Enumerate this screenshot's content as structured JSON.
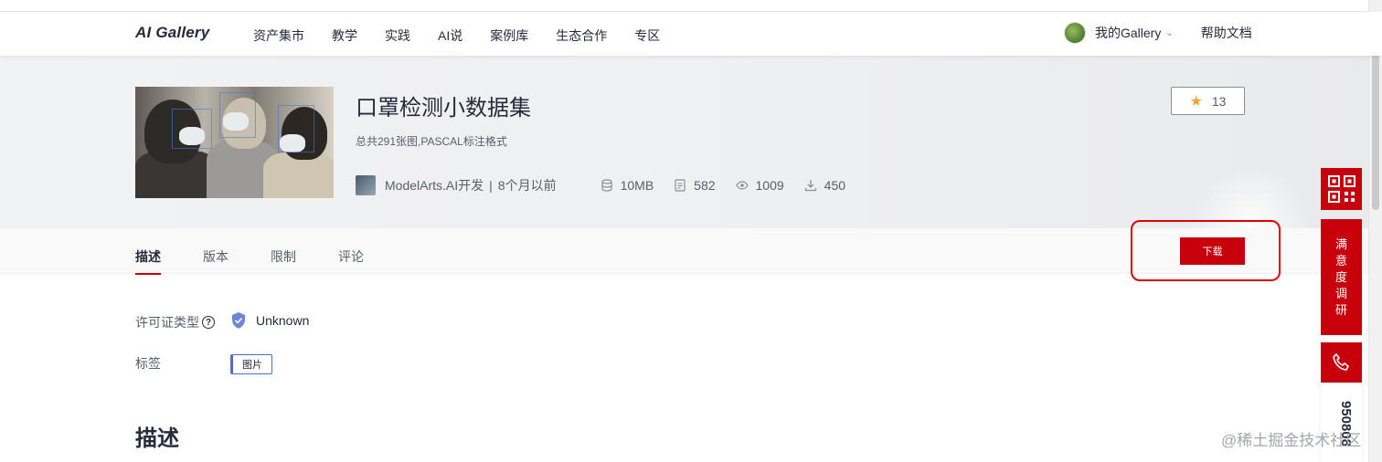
{
  "brand": {
    "logo_prefix": "AI G",
    "logo_suffix": "allery",
    "accent": "#c7000b"
  },
  "nav": {
    "menu": [
      "资产集市",
      "教学",
      "实践",
      "AI说",
      "案例库",
      "生态合作",
      "专区"
    ],
    "my_gallery": "我的Gallery",
    "help": "帮助文档"
  },
  "dataset": {
    "title": "口罩检测小数据集",
    "subtitle": "总共291张图,PASCAL标注格式",
    "publisher": "ModelArts.AI开发",
    "separator": "|",
    "published": "8个月以前",
    "size": "10MB",
    "files": "582",
    "views": "1009",
    "downloads": "450",
    "stars": "13"
  },
  "tabs": [
    "描述",
    "版本",
    "限制",
    "评论"
  ],
  "download_label": "下载",
  "info": {
    "license_label": "许可证类型",
    "license_value": "Unknown",
    "tags_label": "标签",
    "tags": [
      "图片"
    ]
  },
  "section_title": "描述",
  "side": {
    "survey": [
      "满",
      "意",
      "度",
      "调",
      "研"
    ],
    "phone_number": "950808"
  },
  "watermark": "@稀土掘金技术社区"
}
